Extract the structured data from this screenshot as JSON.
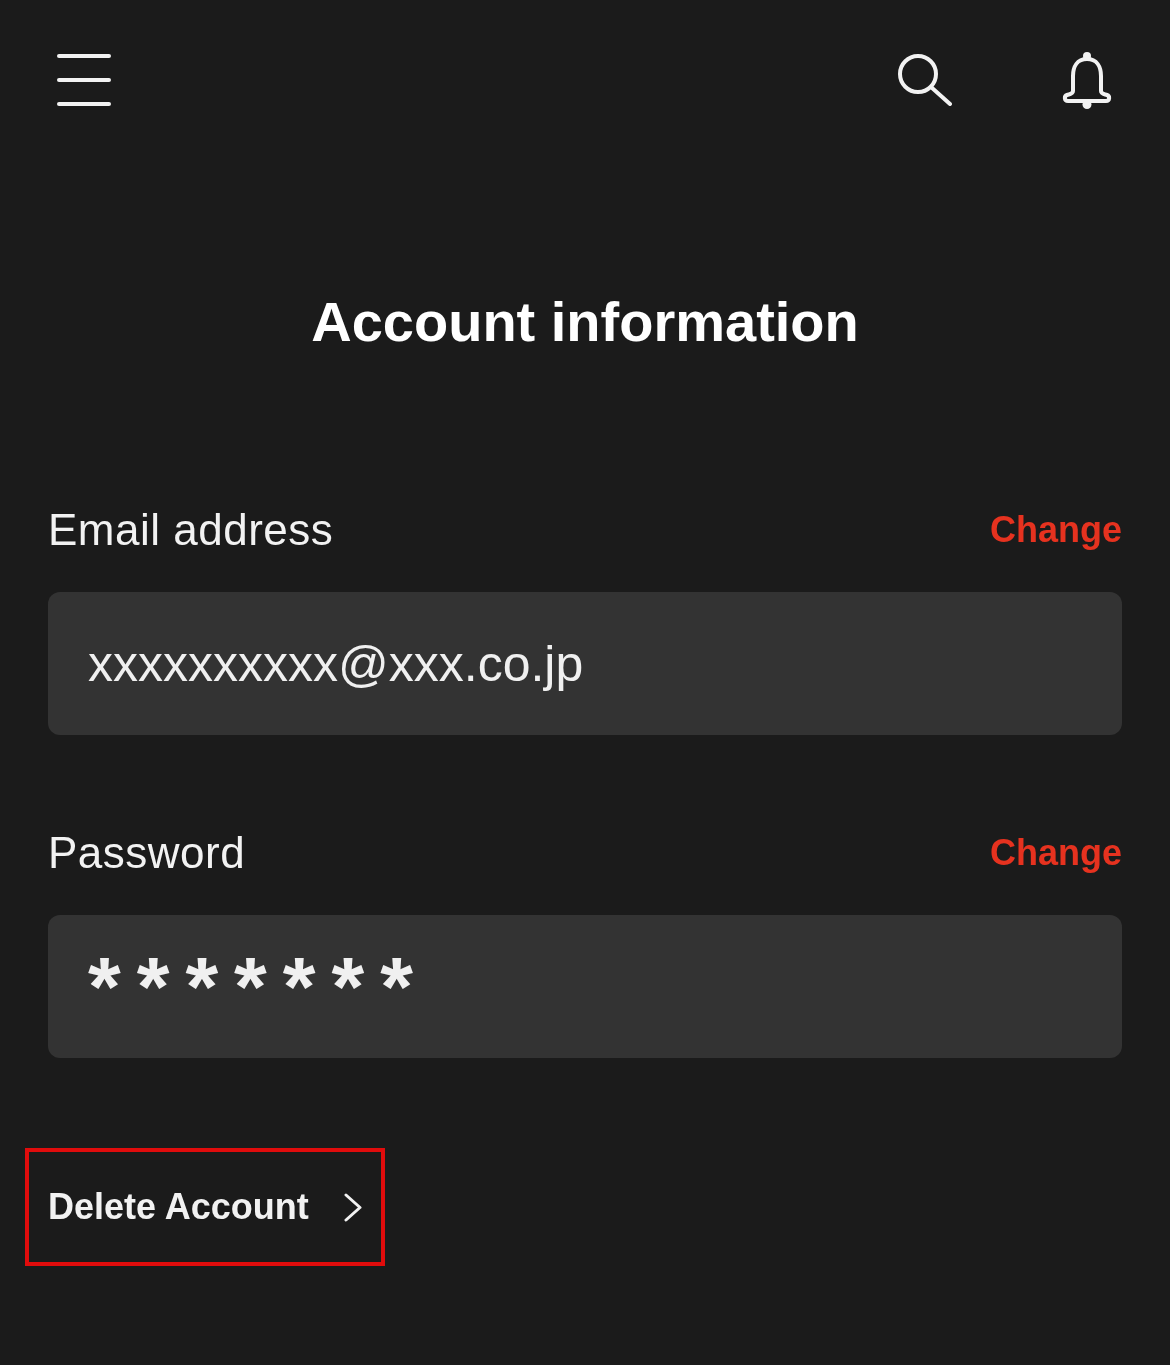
{
  "title": "Account information",
  "fields": [
    {
      "kind": "email",
      "label": "Email address",
      "action": "Change",
      "value": "xxxxxxxxxx@xxx.co.jp"
    },
    {
      "kind": "password",
      "label": "Password",
      "action": "Change",
      "value": "*******"
    }
  ],
  "delete_account": {
    "label": "Delete Account",
    "highlighted": true
  }
}
